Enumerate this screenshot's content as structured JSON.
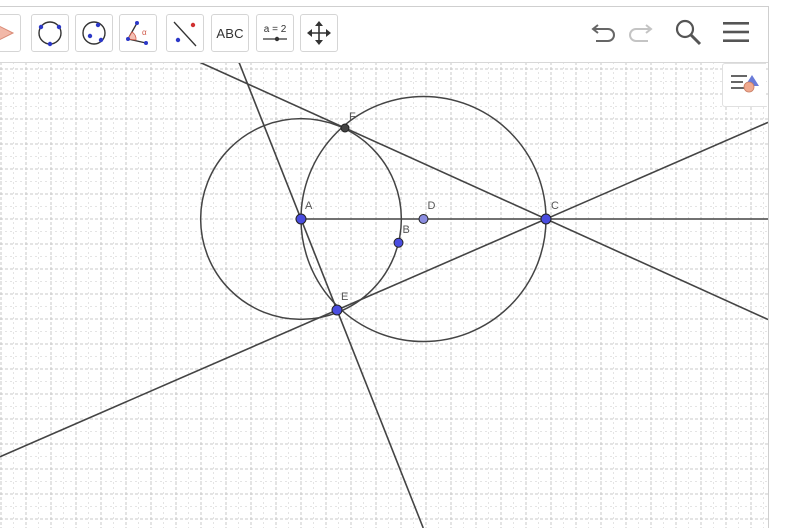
{
  "toolbar": {
    "tools": [
      {
        "name": "polygon-tool",
        "icon": "polygon-icon"
      },
      {
        "name": "circle-center-point-tool",
        "icon": "circle-center-point-icon"
      },
      {
        "name": "circle-three-points-tool",
        "icon": "circle-three-points-icon"
      },
      {
        "name": "angle-tool",
        "icon": "angle-icon"
      },
      {
        "name": "reflect-about-line-tool",
        "icon": "reflect-icon"
      },
      {
        "name": "text-tool",
        "label": "ABC"
      },
      {
        "name": "slider-tool",
        "label": "a = 2"
      },
      {
        "name": "move-graphics-view-tool",
        "icon": "move-icon"
      }
    ],
    "controls": [
      {
        "name": "undo-button",
        "icon": "undo-icon"
      },
      {
        "name": "redo-button",
        "icon": "redo-icon"
      },
      {
        "name": "search-button",
        "icon": "search-icon"
      },
      {
        "name": "menu-button",
        "icon": "hamburger-menu-icon"
      }
    ]
  },
  "style_bar_toggle": {
    "icon": "style-bar-toggle-icon"
  },
  "construction": {
    "points": [
      {
        "label": "A",
        "x": 0,
        "y": 0
      },
      {
        "label": "B",
        "x": 3.9,
        "y": -0.95
      },
      {
        "label": "C",
        "x": 9.8,
        "y": 0
      },
      {
        "label": "D",
        "x": 4.9,
        "y": 0
      },
      {
        "label": "E",
        "x": 1.44,
        "y": -3.64
      },
      {
        "label": "F",
        "x": 1.76,
        "y": 3.64
      }
    ],
    "circles": [
      {
        "center": "A",
        "through": "B"
      },
      {
        "center": "D",
        "through": "A"
      }
    ],
    "lines": [
      {
        "through": [
          "C",
          "E"
        ]
      },
      {
        "through": [
          "C",
          "F"
        ]
      },
      {
        "through": [
          "A",
          "E"
        ]
      }
    ],
    "rays": [
      {
        "from": "A",
        "through": "C"
      }
    ]
  },
  "colors": {
    "free_point": "#4a4de0",
    "dependent_point": "#444444",
    "point_on_object": "#8a8ce0",
    "line": "#444444",
    "grid_major": "#c8c8c8",
    "grid_minor": "#e4e4e4",
    "toolbar_border": "#d5d5d5"
  },
  "view": {
    "grid": "on"
  }
}
